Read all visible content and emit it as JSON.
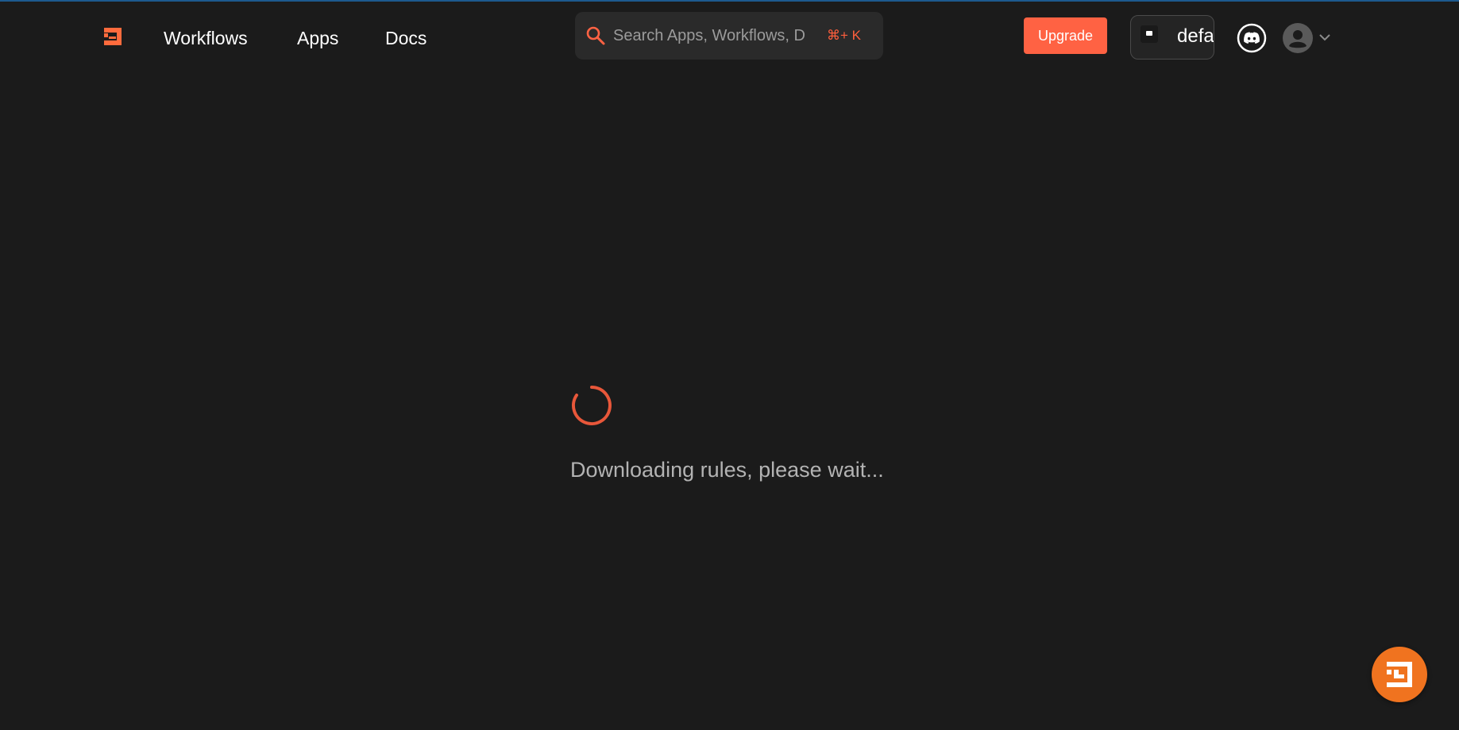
{
  "nav": {
    "links": [
      {
        "label": "Workflows"
      },
      {
        "label": "Apps"
      },
      {
        "label": "Docs"
      }
    ]
  },
  "search": {
    "placeholder": "Search Apps, Workflows, D",
    "shortcut": "⌘+ K"
  },
  "header": {
    "upgrade_label": "Upgrade",
    "workspace_name": "defa"
  },
  "loading": {
    "message": "Downloading rules, please wait..."
  },
  "icons": {
    "logo": "brand-logo-icon",
    "search": "search-icon",
    "discord": "discord-icon",
    "avatar": "user-avatar-icon",
    "chevron": "chevron-down-icon",
    "spinner": "loading-spinner-icon"
  },
  "colors": {
    "accent": "#ff6243",
    "background": "#1b1b1b",
    "fab": "#f0731f"
  }
}
